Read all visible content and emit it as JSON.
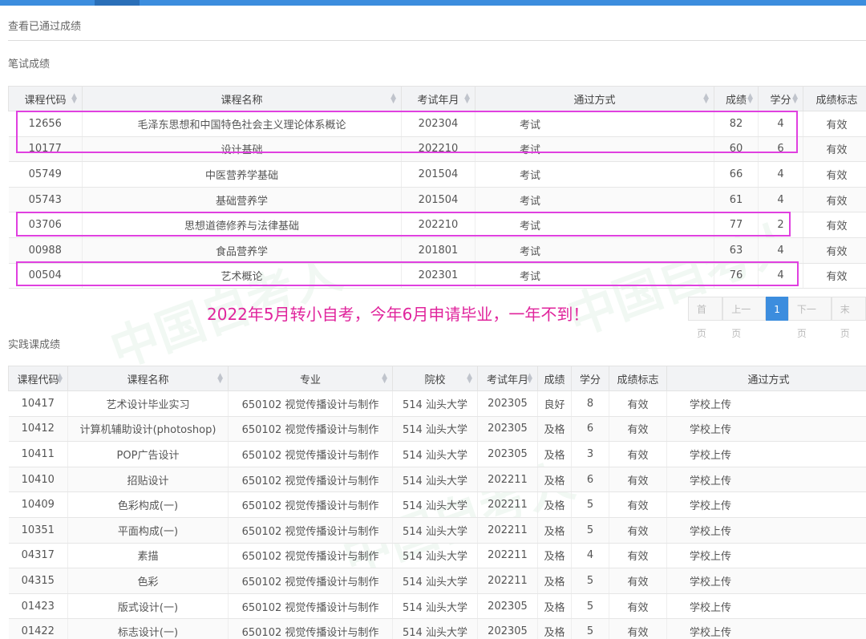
{
  "page_title": "查看已通过成绩",
  "written": {
    "section_title": "笔试成绩",
    "headers": [
      "课程代码",
      "课程名称",
      "考试年月",
      "通过方式",
      "成绩",
      "学分",
      "成绩标志"
    ],
    "rows": [
      [
        "12656",
        "毛泽东思想和中国特色社会主义理论体系概论",
        "202304",
        "考试",
        "82",
        "4",
        "有效"
      ],
      [
        "10177",
        "设计基础",
        "202210",
        "考试",
        "60",
        "6",
        "有效"
      ],
      [
        "05749",
        "中医营养学基础",
        "201504",
        "考试",
        "66",
        "4",
        "有效"
      ],
      [
        "05743",
        "基础营养学",
        "201504",
        "考试",
        "61",
        "4",
        "有效"
      ],
      [
        "03706",
        "思想道德修养与法律基础",
        "202210",
        "考试",
        "77",
        "2",
        "有效"
      ],
      [
        "00988",
        "食品营养学",
        "201801",
        "考试",
        "63",
        "4",
        "有效"
      ],
      [
        "00504",
        "艺术概论",
        "202301",
        "考试",
        "76",
        "4",
        "有效"
      ]
    ]
  },
  "pager": {
    "first": "首页",
    "prev": "上一页",
    "current": "1",
    "next": "下一页",
    "last": "末页"
  },
  "banner": "2022年5月转小自考，今年6月申请毕业，一年不到！",
  "practice": {
    "section_title": "实践课成绩",
    "headers": [
      "课程代码",
      "课程名称",
      "专业",
      "院校",
      "考试年月",
      "成绩",
      "学分",
      "成绩标志",
      "通过方式"
    ],
    "rows": [
      [
        "10417",
        "艺术设计毕业实习",
        "650102 视觉传播设计与制作",
        "514 汕头大学",
        "202305",
        "良好",
        "8",
        "有效",
        "学校上传"
      ],
      [
        "10412",
        "计算机辅助设计(photoshop)",
        "650102 视觉传播设计与制作",
        "514 汕头大学",
        "202305",
        "及格",
        "6",
        "有效",
        "学校上传"
      ],
      [
        "10411",
        "POP广告设计",
        "650102 视觉传播设计与制作",
        "514 汕头大学",
        "202305",
        "及格",
        "3",
        "有效",
        "学校上传"
      ],
      [
        "10410",
        "招贴设计",
        "650102 视觉传播设计与制作",
        "514 汕头大学",
        "202211",
        "及格",
        "6",
        "有效",
        "学校上传"
      ],
      [
        "10409",
        "色彩构成(一)",
        "650102 视觉传播设计与制作",
        "514 汕头大学",
        "202211",
        "及格",
        "5",
        "有效",
        "学校上传"
      ],
      [
        "10351",
        "平面构成(一)",
        "650102 视觉传播设计与制作",
        "514 汕头大学",
        "202211",
        "及格",
        "5",
        "有效",
        "学校上传"
      ],
      [
        "04317",
        "素描",
        "650102 视觉传播设计与制作",
        "514 汕头大学",
        "202211",
        "及格",
        "4",
        "有效",
        "学校上传"
      ],
      [
        "04315",
        "色彩",
        "650102 视觉传播设计与制作",
        "514 汕头大学",
        "202211",
        "及格",
        "5",
        "有效",
        "学校上传"
      ],
      [
        "01423",
        "版式设计(一)",
        "650102 视觉传播设计与制作",
        "514 汕头大学",
        "202305",
        "及格",
        "5",
        "有效",
        "学校上传"
      ],
      [
        "01422",
        "标志设计(一)",
        "650102 视觉传播设计与制作",
        "514 汕头大学",
        "202305",
        "及格",
        "5",
        "有效",
        "学校上传"
      ]
    ]
  },
  "watermark": "中国自考人",
  "colors": {
    "accent": "#3c8dde",
    "highlight": "#e040e0",
    "banner": "#e0249c"
  }
}
